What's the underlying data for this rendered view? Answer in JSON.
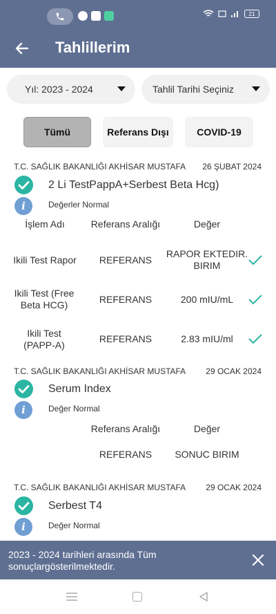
{
  "status_bar": {
    "battery": "21"
  },
  "app_bar": {
    "title": "Tahlillerim"
  },
  "filters": {
    "year_label": "Yıl: 2023 - 2024",
    "date_label": "Tahlil Tarihi Seçiniz"
  },
  "tabs": [
    {
      "label": "Tümü",
      "active": true
    },
    {
      "label": "Referans Dışı",
      "active": false
    },
    {
      "label": "COVID-19",
      "active": false
    }
  ],
  "results": [
    {
      "institution": "T.C. SAĞLIK BAKANLIĞI AKHİSAR MUSTAFA",
      "date": "26 ŞUBAT 2024",
      "test_name": "2 Li TestPappA+Serbest Beta Hcg)",
      "status": "Değerler Normal",
      "headers": {
        "name": "İşlem Adı",
        "range": "Referans Aralığı",
        "value": "Değer"
      },
      "rows": [
        {
          "name": "Ikili Test Rapor",
          "range": "REFERANS",
          "value": "RAPOR EKTEDIR. BIRIM"
        },
        {
          "name": "Ikili Test (Free Beta HCG)",
          "range": "REFERANS",
          "value": "200 mIU/mL"
        },
        {
          "name": "Ikili Test (PAPP-A)",
          "range": "REFERANS",
          "value": "2.83 mIU/ml"
        }
      ]
    },
    {
      "institution": "T.C. SAĞLIK BAKANLIĞI AKHİSAR MUSTAFA",
      "date": "29 OCAK 2024",
      "test_name": "Serum Index",
      "status": "Değer Normal",
      "headers": {
        "range": "Referans Aralığı",
        "value": "Değer"
      },
      "rows": [
        {
          "range": "REFERANS",
          "value": "SONUC BIRIM"
        }
      ]
    },
    {
      "institution": "T.C. SAĞLIK BAKANLIĞI AKHİSAR MUSTAFA",
      "date": "29 OCAK 2024",
      "test_name": "Serbest T4",
      "status": "Değer Normal"
    }
  ],
  "snackbar": {
    "text": "2023 - 2024 tarihleri arasında Tüm sonuçlargösterilmektedir."
  },
  "colors": {
    "header": "#5f6f92",
    "check": "#2bb5a3",
    "info": "#6f9fd3"
  }
}
